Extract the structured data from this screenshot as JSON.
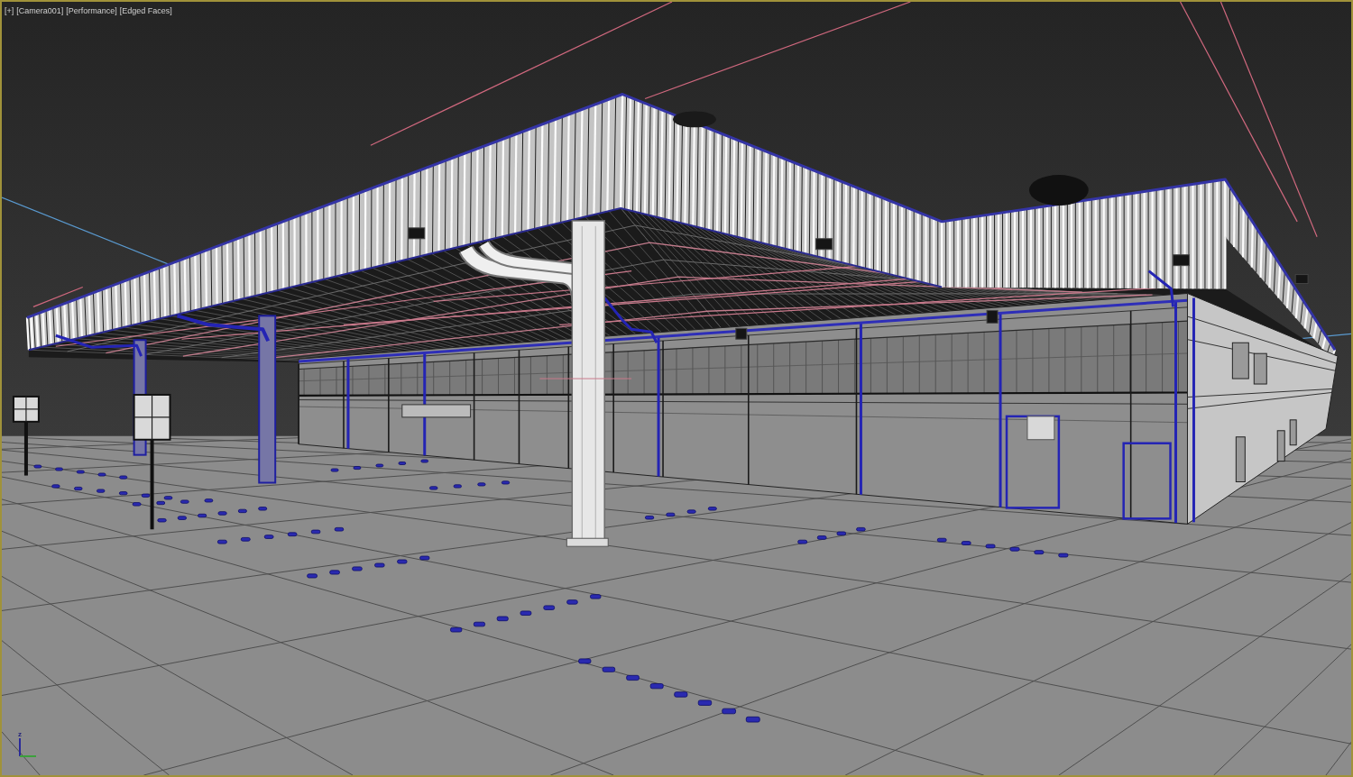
{
  "viewport": {
    "active": true,
    "labels": [
      {
        "text": "[+]"
      },
      {
        "text": "[Camera001]"
      },
      {
        "text": "[Performance]"
      },
      {
        "text": "[Edged Faces]"
      }
    ],
    "axis_gizmo": {
      "label": "z"
    }
  }
}
